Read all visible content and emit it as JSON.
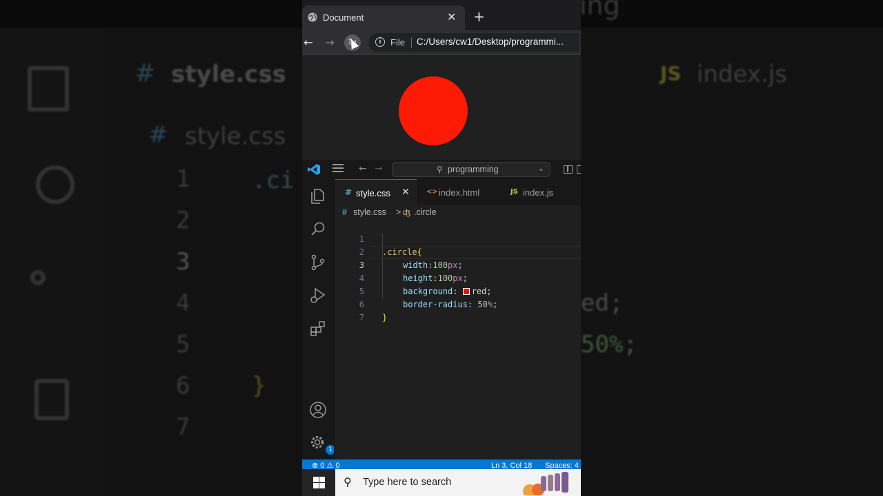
{
  "background": {
    "left_tab": "style.css",
    "left_breadcrumb": "style.css",
    "right_tab": "index.js",
    "right_tab_icon": "JS",
    "line_numbers": [
      "1",
      "2",
      "3",
      "4",
      "5",
      "6",
      "7"
    ],
    "code_fragments": [
      ".ci",
      "}",
      "ed;",
      "50%;"
    ],
    "top_fragment": "ing"
  },
  "browser": {
    "tab_title": "Document",
    "tab_close": "✕",
    "new_tab": "+",
    "back": "←",
    "forward": "→",
    "reload": "↻",
    "address_scheme": "File",
    "address_url": "C:/Users/cw1/Desktop/programmi...",
    "circle_color": "#ff1a05"
  },
  "vscode": {
    "search_text": "programming",
    "tabs": [
      {
        "label": "style.css",
        "icon": "#",
        "icon_color": "#519aba",
        "close": "✕"
      },
      {
        "label": "index.html",
        "icon": "<>",
        "icon_color": "#e37933"
      },
      {
        "label": "index.js",
        "icon": "JS",
        "icon_color": "#cbcb41"
      }
    ],
    "breadcrumb": {
      "file_icon": "#",
      "file": "style.css",
      "sep": ">",
      "symbol": ".circle"
    },
    "line_numbers": [
      "1",
      "2",
      "3",
      "4",
      "5",
      "6",
      "7"
    ],
    "code": {
      "selector": ".circle",
      "open_brace": "{",
      "close_brace": "}",
      "lines": [
        {
          "prop": "width",
          "colon": ":",
          "num": "100",
          "unit": "px",
          "semi": ";"
        },
        {
          "prop": "height",
          "colon": ":",
          "num": "100",
          "unit": "px",
          "semi": ";"
        },
        {
          "prop": "background",
          "colon": ": ",
          "value": "red",
          "semi": ";",
          "swatch": "#ff0000"
        },
        {
          "prop": "border-radius",
          "colon": ": ",
          "num": "50",
          "unit": "%",
          "semi": ";"
        }
      ]
    },
    "settings_badge": "1",
    "status": {
      "problems": "⊗ 0 ⚠ 0",
      "position": "Ln 3, Col 18",
      "spaces": "Spaces: 4"
    }
  },
  "taskbar": {
    "search_placeholder": "Type here to search"
  },
  "colors": {
    "accent": "#0078d4",
    "css_icon": "#519aba",
    "html_icon": "#e37933",
    "js_icon": "#cbcb41",
    "selector": "#d7ba7d",
    "brace": "#ffd700",
    "property": "#9cdcfe",
    "number": "#b5cea8",
    "unit": "#c586c0",
    "text": "#d4d4d4"
  }
}
